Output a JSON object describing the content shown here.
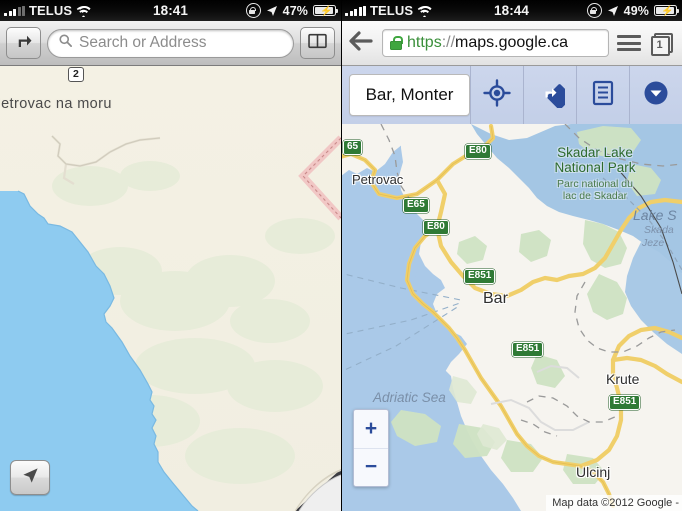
{
  "left_panel": {
    "app": "Mobile Safari",
    "status_bar": {
      "carrier": "TELUS",
      "wifi_icon": "wifi-icon",
      "time": "18:41",
      "rotation_lock_icon": "rotation-lock-icon",
      "location_icon": "location-arrow-icon",
      "battery_percent": "47%",
      "battery_icon": "battery-charging-icon"
    },
    "browser_bar": {
      "share_icon": "share-arrow-icon",
      "search_placeholder": "Search or Address",
      "search_value": "",
      "search_icon": "search-icon",
      "bookmarks_icon": "bookmarks-book-icon"
    },
    "map": {
      "labels": [
        {
          "text": "Petrovac na moru",
          "kind": "town"
        }
      ],
      "shields": [
        {
          "text": "2"
        }
      ],
      "locate_icon": "locate-arrow-icon",
      "page_curl_icon": "page-curl-icon",
      "colors": {
        "land": "#f2efe2",
        "water": "#8ecbf0",
        "border_dashed": "#e9a7a7"
      }
    }
  },
  "right_panel": {
    "app": "Chrome for iOS",
    "status_bar": {
      "carrier": "TELUS",
      "wifi_icon": "wifi-icon",
      "time": "18:44",
      "rotation_lock_icon": "rotation-lock-icon",
      "location_icon": "location-arrow-icon",
      "battery_percent": "49%",
      "battery_icon": "battery-charging-icon"
    },
    "browser_bar": {
      "back_icon": "back-arrow-icon",
      "lock_icon": "ssl-lock-icon",
      "url_scheme": "https",
      "url_separator": "://",
      "url_host": "maps.google.ca",
      "menu_icon": "hamburger-menu-icon",
      "tabs_icon": "tab-stack-icon",
      "tab_count": "1"
    },
    "maps_toolbar": {
      "search_value": "Bar, Monter",
      "my_location_icon": "my-location-crosshair-icon",
      "directions_icon": "directions-diamond-icon",
      "layers_icon": "list-layers-icon",
      "more_icon": "chevron-down-circle-icon"
    },
    "map": {
      "labels": [
        {
          "text": "Petrovac",
          "kind": "town"
        },
        {
          "text": "Bar",
          "kind": "town"
        },
        {
          "text": "Krute",
          "kind": "town"
        },
        {
          "text": "Ulcinj",
          "kind": "town"
        },
        {
          "text": "Skadar Lake",
          "kind": "park"
        },
        {
          "text": "National Park",
          "kind": "park"
        },
        {
          "text": "Parc national du",
          "kind": "park-sub"
        },
        {
          "text": "lac de Skadar",
          "kind": "park-sub"
        },
        {
          "text": "Adriatic Sea",
          "kind": "sea"
        },
        {
          "text": "Lake S",
          "kind": "lake"
        },
        {
          "text": "Skada",
          "kind": "lake-sub"
        },
        {
          "text": "Jeze",
          "kind": "lake-sub"
        }
      ],
      "shields": [
        "65",
        "E80",
        "E65",
        "E80",
        "E851",
        "E851",
        "E851"
      ],
      "zoom_in_label": "+",
      "zoom_out_label": "−",
      "attribution": "Map data ©2012 Google -",
      "colors": {
        "land": "#f6f4ef",
        "water": "#aac9e8",
        "green": "#cfe3c3",
        "road": "#f5d97a",
        "shield_green": "#2f7a35"
      }
    }
  }
}
